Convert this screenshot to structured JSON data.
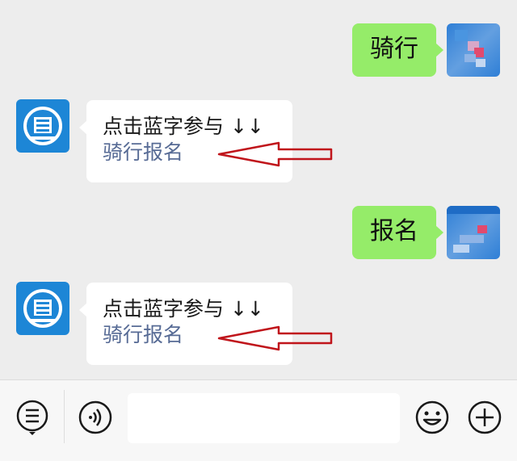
{
  "messages": [
    {
      "side": "right",
      "text": "骑行"
    },
    {
      "side": "left",
      "line1": "点击蓝字参与 ↓↓",
      "line2": "骑行报名"
    },
    {
      "side": "right",
      "text": "报名"
    },
    {
      "side": "left",
      "line1": "点击蓝字参与 ↓↓",
      "line2": "骑行报名"
    }
  ],
  "colors": {
    "background": "#ededed",
    "bubble_sent": "#95ec69",
    "bubble_received": "#ffffff",
    "link": "#576b95",
    "arrow": "#c0151b"
  },
  "input_bar": {
    "icons": [
      "menu-icon",
      "voice-icon",
      "emoji-icon",
      "plus-icon"
    ],
    "text_value": ""
  }
}
